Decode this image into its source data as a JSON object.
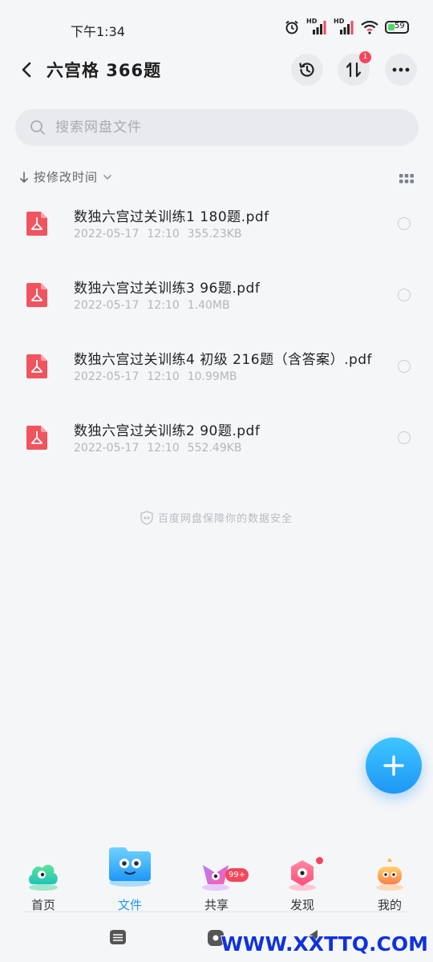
{
  "status_bar": {
    "time": "下午1:34",
    "hd1": "HD",
    "hd2": "HD",
    "battery": "59"
  },
  "header": {
    "title": "六宫格 366题",
    "transfer_badge": "1"
  },
  "search": {
    "placeholder": "搜索网盘文件"
  },
  "sort": {
    "label": "按修改时间"
  },
  "files": [
    {
      "name": "数独六宫过关训练1 180题.pdf",
      "date": "2022-05-17",
      "time": "12:10",
      "size": "355.23KB"
    },
    {
      "name": "数独六宫过关训练3 96题.pdf",
      "date": "2022-05-17",
      "time": "12:10",
      "size": "1.40MB"
    },
    {
      "name": "数独六宫过关训练4 初级 216题（含答案）.pdf",
      "date": "2022-05-17",
      "time": "12:10",
      "size": "10.99MB"
    },
    {
      "name": "数独六宫过关训练2 90题.pdf",
      "date": "2022-05-17",
      "time": "12:10",
      "size": "552.49KB"
    }
  ],
  "safety_note": "百度网盘保障你的数据安全",
  "bottom_nav": {
    "items": [
      {
        "label": "首页"
      },
      {
        "label": "文件"
      },
      {
        "label": "共享"
      },
      {
        "label": "发现"
      },
      {
        "label": "我的"
      }
    ],
    "share_badge": "99+"
  },
  "watermark": "WWW.XXTTQ.COM",
  "colors": {
    "accent": "#1e97f6",
    "pdf_red": "#f0545e",
    "badge_red": "#f5455b"
  }
}
